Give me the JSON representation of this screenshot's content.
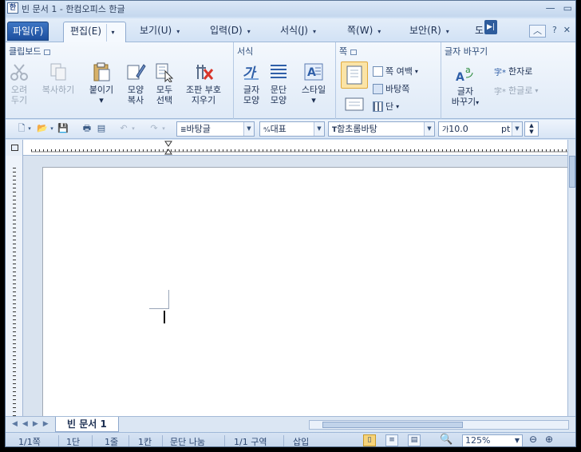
{
  "window": {
    "title": "빈 문서 1 - 한컴오피스 한글"
  },
  "menu": {
    "tabs": [
      {
        "label": "파일(F)"
      },
      {
        "label": "편집(E)"
      },
      {
        "label": "보기(U)"
      },
      {
        "label": "입력(D)"
      },
      {
        "label": "서식(J)"
      },
      {
        "label": "쪽(W)"
      },
      {
        "label": "보안(R)"
      },
      {
        "label": "도"
      }
    ],
    "help": "?",
    "scroll": "▶|"
  },
  "ribbon": {
    "groups": [
      {
        "title": "클립보드"
      },
      {
        "title": "서식"
      },
      {
        "title": "쪽"
      },
      {
        "title": "글자 바꾸기"
      }
    ],
    "clipboard": {
      "cut_line1": "오려",
      "cut_line2": "두기",
      "copy": "복사하기",
      "paste": "붙이기",
      "format_copy_line1": "모양",
      "format_copy_line2": "복사",
      "select_all_line1": "모두",
      "select_all_line2": "선택",
      "erase_line1": "조판 부호",
      "erase_line2": "지우기"
    },
    "format": {
      "char_line1": "글자",
      "char_line2": "모양",
      "para_line1": "문단",
      "para_line2": "모양",
      "style": "스타일"
    },
    "page": {
      "margin": "쪽 여백",
      "master": "바탕쪽",
      "column": "단"
    },
    "convert": {
      "change_line1": "글자",
      "change_line2": "바꾸기",
      "hanja": "한자로",
      "hangul": "한글로"
    }
  },
  "toolbar": {
    "style": "바탕글",
    "lang": "대표",
    "font": "함초롬바탕",
    "size": "10.0",
    "unit": "pt"
  },
  "doc_tabs": {
    "active": "빈 문서 1"
  },
  "status": {
    "page": "1/1쪽",
    "column": "1단",
    "line": "1줄",
    "col": "1칸",
    "para_split": "문단 나눔",
    "section": "1/1 구역",
    "insert": "삽입",
    "zoom": "125%"
  }
}
